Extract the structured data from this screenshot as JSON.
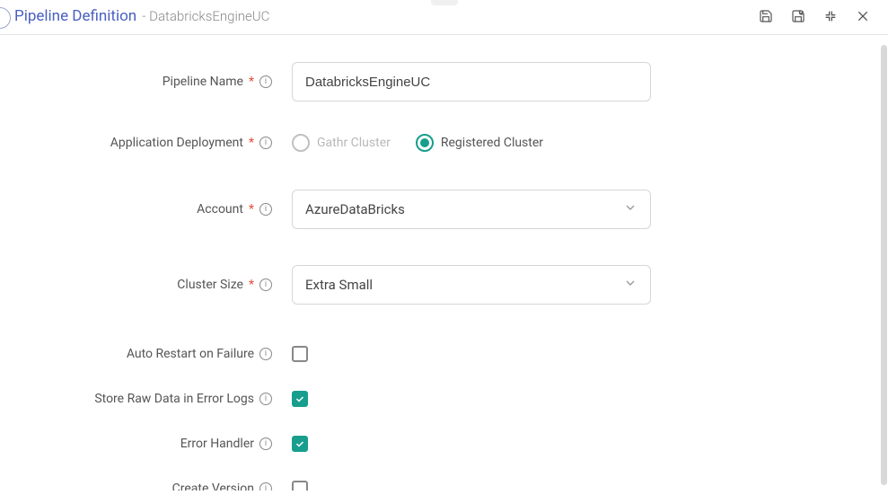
{
  "header": {
    "title": "Pipeline Definition",
    "subtitle": "- DatabricksEngineUC"
  },
  "form": {
    "pipeline_name_label": "Pipeline Name",
    "pipeline_name_value": "DatabricksEngineUC",
    "app_deployment_label": "Application Deployment",
    "gathr_cluster_label": "Gathr Cluster",
    "registered_cluster_label": "Registered Cluster",
    "account_label": "Account",
    "account_value": "AzureDataBricks",
    "cluster_size_label": "Cluster Size",
    "cluster_size_value": "Extra Small",
    "auto_restart_label": "Auto Restart on Failure",
    "store_raw_label": "Store Raw Data in Error Logs",
    "error_handler_label": "Error Handler",
    "create_version_label": "Create Version"
  }
}
